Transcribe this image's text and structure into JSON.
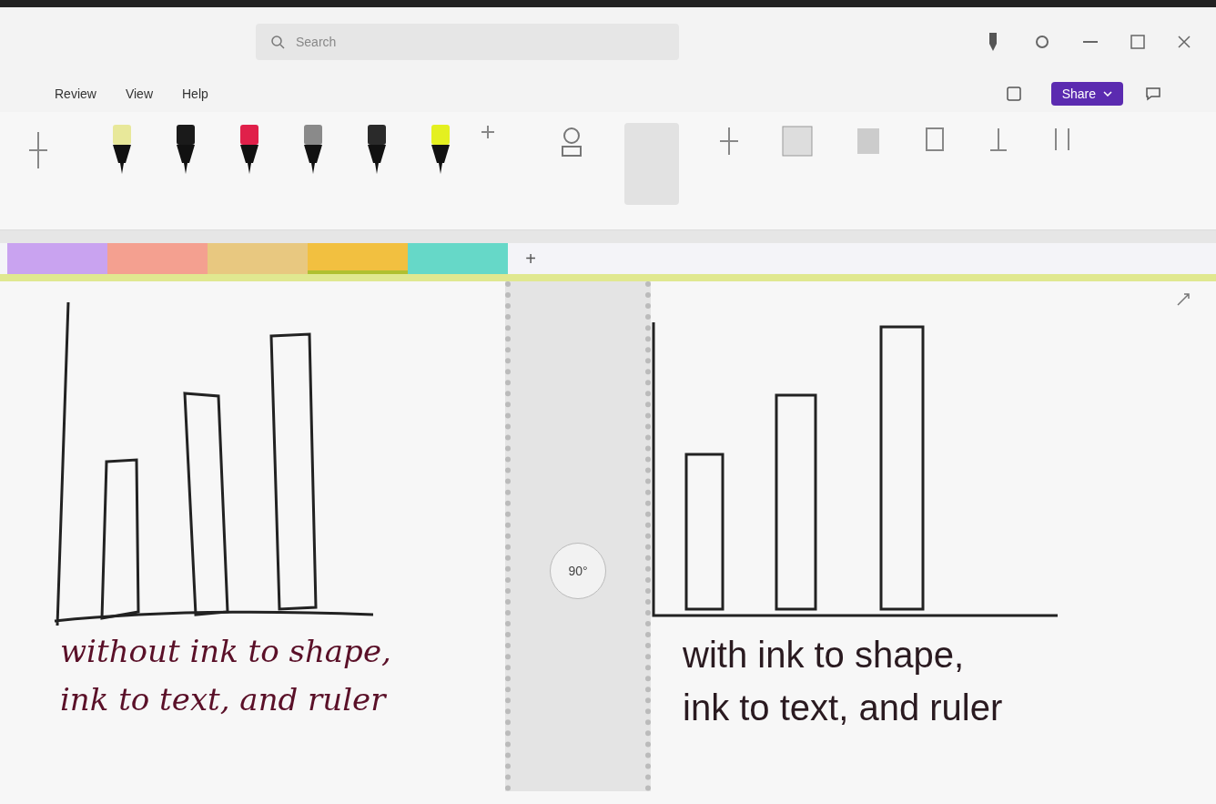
{
  "title_bar": {
    "search_placeholder": "Search"
  },
  "menu": [
    "Review",
    "View",
    "Help"
  ],
  "share": {
    "label": "Share"
  },
  "pens": [
    {
      "color": "#e8e89a"
    },
    {
      "color": "#1a1a1a"
    },
    {
      "color": "#e0204a"
    },
    {
      "color": "#8a8a8a"
    },
    {
      "color": "#2a2a2a"
    },
    {
      "color": "#e4f020"
    }
  ],
  "section_tabs": [
    {
      "color": "#c9a3f0",
      "selected": false
    },
    {
      "color": "#f4a090",
      "selected": false
    },
    {
      "color": "#e8c880",
      "selected": false
    },
    {
      "color": "#f2c040",
      "selected": true
    },
    {
      "color": "#66d8c8",
      "selected": false
    }
  ],
  "add_tab": "+",
  "ruler": {
    "angle": "90°"
  },
  "left_note": [
    "without ink to shape,",
    "ink to text, and ruler"
  ],
  "right_note": [
    "with ink to shape,",
    "ink to text, and ruler"
  ]
}
